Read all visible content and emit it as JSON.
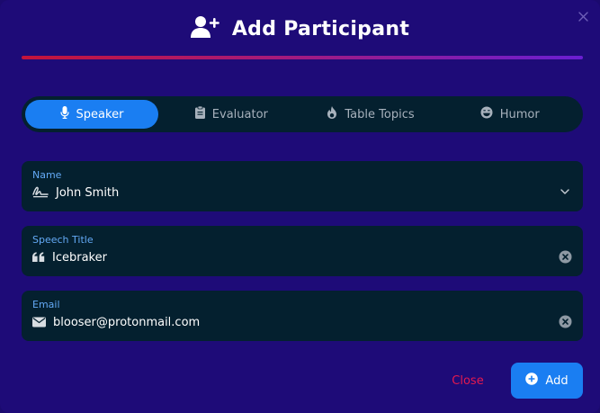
{
  "dialog": {
    "title": "Add Participant",
    "icons": {
      "header": "user-plus-icon",
      "close": "close-icon"
    }
  },
  "tabs": [
    {
      "label": "Speaker",
      "icon": "microphone-icon",
      "active": true
    },
    {
      "label": "Evaluator",
      "icon": "clipboard-icon",
      "active": false
    },
    {
      "label": "Table Topics",
      "icon": "fire-icon",
      "active": false
    },
    {
      "label": "Humor",
      "icon": "laugh-icon",
      "active": false
    }
  ],
  "fields": {
    "name": {
      "label": "Name",
      "value": "John Smith",
      "icon": "signature-icon",
      "right_icon": "chevron-down-icon"
    },
    "speech_title": {
      "label": "Speech Title",
      "value": "Icebraker",
      "icon": "quote-icon",
      "right_icon": "clear-icon"
    },
    "email": {
      "label": "Email",
      "value": "blooser@protonmail.com",
      "icon": "envelope-icon",
      "right_icon": "clear-icon"
    }
  },
  "actions": {
    "close_label": "Close",
    "add_label": "Add",
    "add_icon": "plus-circle-icon"
  },
  "colors": {
    "background": "#1e0b78",
    "field_bg": "#04202f",
    "accent": "#1a7ef2",
    "label": "#63a9f5",
    "danger": "#e5194f",
    "gradient_start": "#c4143a",
    "gradient_end": "#6a1ed2"
  }
}
